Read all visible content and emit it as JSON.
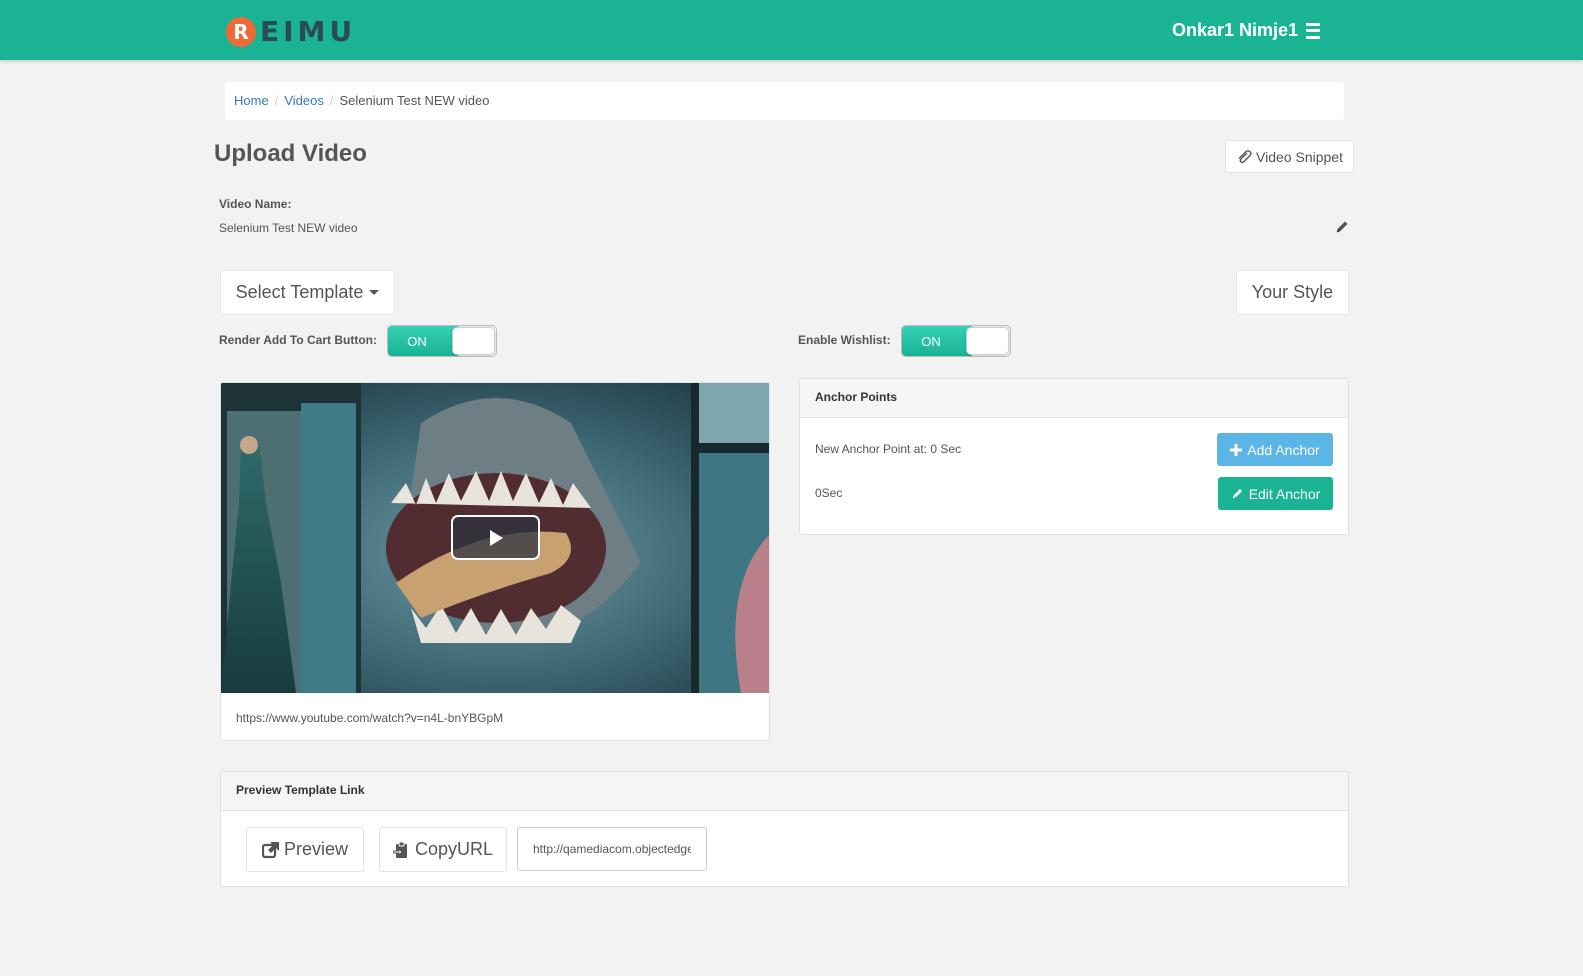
{
  "app": {
    "logo_letter": "R",
    "logo_text": "EIMU",
    "user_name": "Onkar1 Nimje1"
  },
  "breadcrumb": {
    "items": [
      "Home",
      "Videos"
    ],
    "current": "Selenium Test NEW video"
  },
  "page": {
    "title": "Upload Video",
    "snippet_label": "Video Snippet",
    "video_name_label": "Video Name:",
    "video_name_value": "Selenium Test NEW video",
    "select_template_label": "Select Template",
    "your_style_label": "Your Style"
  },
  "toggles": {
    "add_to_cart_label": "Render Add To Cart Button:",
    "add_to_cart_state": "ON",
    "wishlist_label": "Enable Wishlist:",
    "wishlist_state": "ON"
  },
  "video": {
    "url": "https://www.youtube.com/watch?v=n4L-bnYBGpM"
  },
  "anchors": {
    "heading": "Anchor Points",
    "new_anchor_text": "New Anchor Point at: 0 Sec",
    "add_label": "Add Anchor",
    "existing_anchor": "0Sec",
    "edit_label": "Edit Anchor"
  },
  "preview": {
    "heading": "Preview Template Link",
    "preview_label": "Preview",
    "copy_label": "CopyURL",
    "url_value": "http://qamediacom.objectedge.com"
  },
  "colors": {
    "brand": "#1ab394",
    "logo_accent": "#f06a35",
    "info_button": "#5bb5e6",
    "link": "#337ab7"
  }
}
